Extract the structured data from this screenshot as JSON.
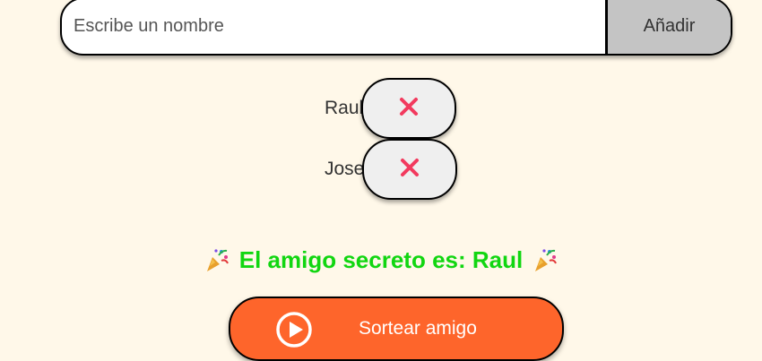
{
  "input": {
    "placeholder": "Escribe un nombre",
    "add_label": "Añadir"
  },
  "friends": [
    {
      "name": "Raul",
      "remove_icon": "close-icon"
    },
    {
      "name": "Jose",
      "remove_icon": "close-icon"
    }
  ],
  "result": {
    "text": "El amigo secreto es: Raul",
    "icon": "party-popper-icon",
    "color": "#11d611"
  },
  "draw_button": {
    "label": "Sortear amigo",
    "icon": "play-circle-icon",
    "color": "#fe652b"
  },
  "colors": {
    "background": "#fff8e9",
    "remove_icon": "#f23a5e"
  }
}
